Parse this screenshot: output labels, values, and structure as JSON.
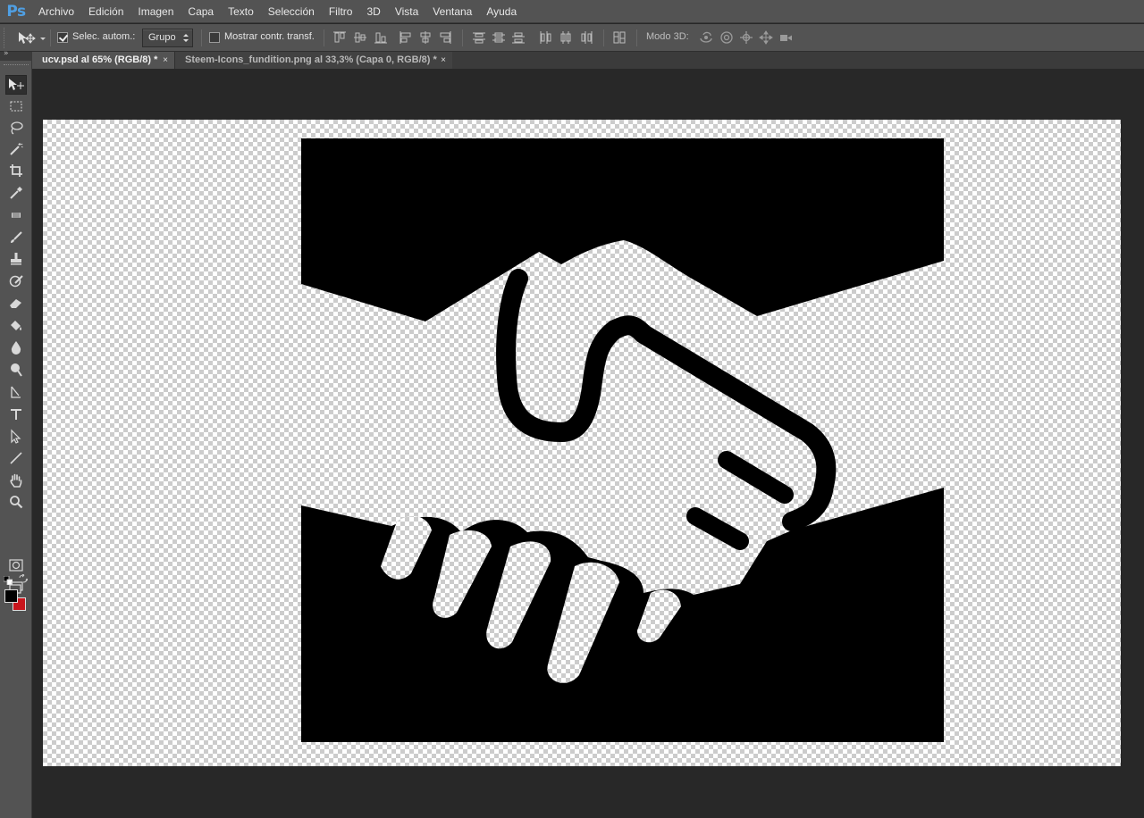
{
  "app": {
    "logo": "Ps",
    "menu": [
      "Archivo",
      "Edición",
      "Imagen",
      "Capa",
      "Texto",
      "Selección",
      "Filtro",
      "3D",
      "Vista",
      "Ventana",
      "Ayuda"
    ]
  },
  "options": {
    "auto_select_label": "Selec. autom.:",
    "auto_select_checked": true,
    "auto_select_value": "Grupo",
    "show_transform_label": "Mostrar contr. transf.",
    "show_transform_checked": false,
    "mode3d_label": "Modo 3D:"
  },
  "tabs": [
    {
      "label": "ucv.psd al 65% (RGB/8) *",
      "active": true,
      "close": "×"
    },
    {
      "label": "Steem-Icons_fundition.png al 33,3% (Capa 0, RGB/8) *",
      "active": false,
      "close": "×"
    }
  ],
  "toolbox": {
    "head_glyph": "»",
    "tools": [
      "move",
      "marquee",
      "lasso",
      "magic-wand",
      "crop",
      "eyedropper",
      "healing",
      "brush",
      "stamp",
      "history-brush",
      "eraser",
      "paint-bucket",
      "blur",
      "dodge",
      "pen",
      "type",
      "path-selection",
      "line",
      "hand",
      "zoom"
    ],
    "selected": "move",
    "foreground_color": "#000000",
    "background_color": "#c8161d"
  },
  "document": {
    "artwork": "handshake-icon"
  }
}
